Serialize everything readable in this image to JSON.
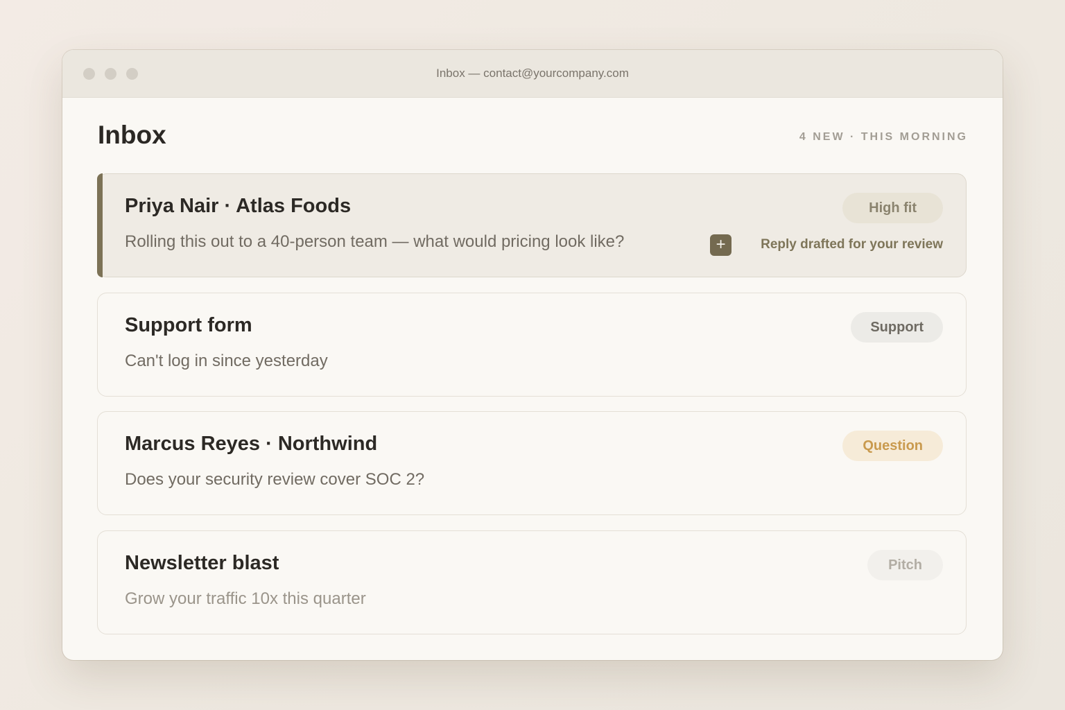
{
  "window": {
    "title": "Inbox — contact@yourcompany.com"
  },
  "header": {
    "title": "Inbox",
    "meta": "4 NEW · THIS MORNING"
  },
  "messages": [
    {
      "sender": "Priya Nair · Atlas Foods",
      "snippet": "Rolling this out to a 40-person team — what would pricing look like?",
      "badge": "High fit",
      "draft_label": "Reply drafted for your review",
      "draft_icon": "plus-icon"
    },
    {
      "sender": "Support form",
      "snippet": "Can't log in since yesterday",
      "badge": "Support"
    },
    {
      "sender": "Marcus Reyes · Northwind",
      "snippet": "Does your security review cover SOC 2?",
      "badge": "Question"
    },
    {
      "sender": "Newsletter blast",
      "snippet": "Grow your traffic 10x this quarter",
      "badge": "Pitch"
    }
  ],
  "colors": {
    "accent": "#7c7256",
    "question": "#c99a4e"
  }
}
